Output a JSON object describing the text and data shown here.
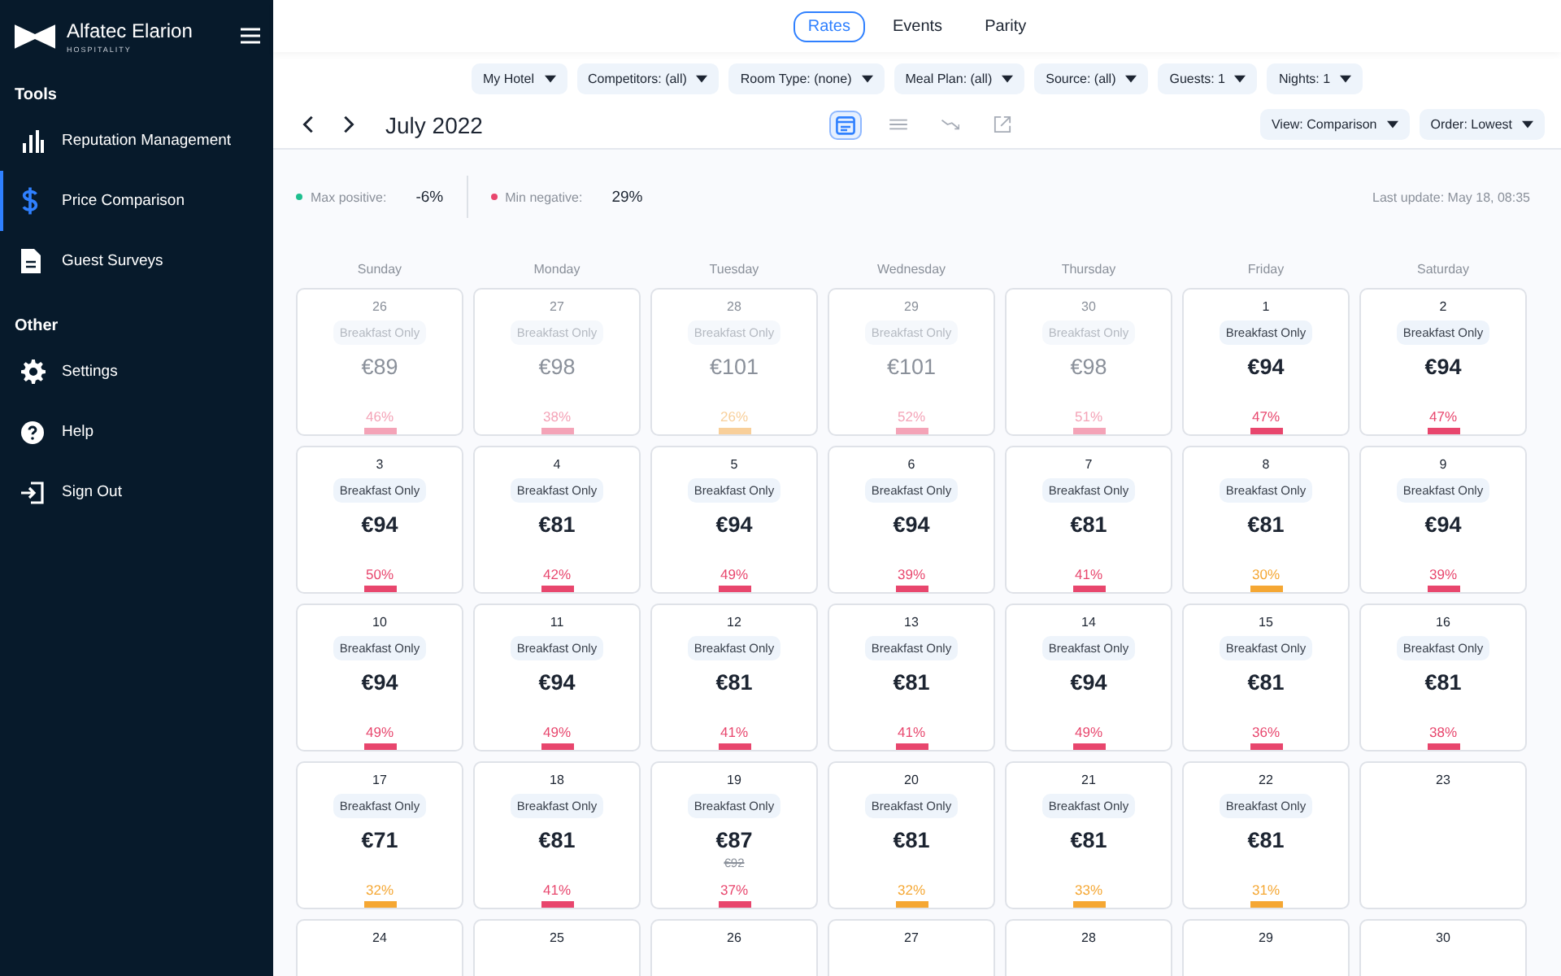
{
  "sidebar": {
    "brand": "Alfatec Elarion",
    "brand_sub": "HOSPITALITY",
    "sections": [
      {
        "title": "Tools",
        "items": [
          {
            "label": "Reputation Management",
            "selected": false
          },
          {
            "label": "Price Comparison",
            "selected": true
          },
          {
            "label": "Guest Surveys",
            "selected": false
          }
        ]
      },
      {
        "title": "Other",
        "items": [
          {
            "label": "Settings",
            "selected": false
          },
          {
            "label": "Help",
            "selected": false
          },
          {
            "label": "Sign Out",
            "selected": false
          }
        ]
      }
    ]
  },
  "tabs": [
    {
      "label": "Rates",
      "selected": true
    },
    {
      "label": "Events",
      "selected": false
    },
    {
      "label": "Parity",
      "selected": false
    }
  ],
  "filters": [
    "My Hotel",
    "Competitors: (all)",
    "Room Type: (none)",
    "Meal Plan: (all)",
    "Source: (all)",
    "Guests: 1",
    "Nights: 1"
  ],
  "toolbar": {
    "month": "July 2022",
    "views": [
      {
        "selected": true
      },
      {
        "selected": false
      },
      {
        "selected": false
      },
      {
        "selected": false
      }
    ],
    "dropdowns": [
      "View: Comparison",
      "Order: Lowest"
    ]
  },
  "stats": {
    "items": [
      {
        "label": "Max positive:",
        "value": "-6%",
        "color": "#1fbf8f"
      },
      {
        "label": "Min negative:",
        "value": "29%",
        "color": "#e8466d"
      }
    ],
    "last_update": "Last update: May 18, 08:35"
  },
  "calendar": {
    "weekdays": [
      "Sunday",
      "Monday",
      "Tuesday",
      "Wednesday",
      "Thursday",
      "Friday",
      "Saturday"
    ],
    "days": [
      {
        "date": "26",
        "past": true,
        "meal": "Breakfast Only",
        "price": "€89",
        "percent": "46%",
        "color": "#f4a3b7"
      },
      {
        "date": "27",
        "past": true,
        "meal": "Breakfast Only",
        "price": "€98",
        "percent": "38%",
        "color": "#f4a3b7"
      },
      {
        "date": "28",
        "past": true,
        "meal": "Breakfast Only",
        "price": "€101",
        "percent": "26%",
        "color": "#f8cf9a"
      },
      {
        "date": "29",
        "past": true,
        "meal": "Breakfast Only",
        "price": "€101",
        "percent": "52%",
        "color": "#f4a3b7"
      },
      {
        "date": "30",
        "past": true,
        "meal": "Breakfast Only",
        "price": "€98",
        "percent": "51%",
        "color": "#f4a3b7"
      },
      {
        "date": "1",
        "past": false,
        "meal": "Breakfast Only",
        "price": "€94",
        "percent": "47%",
        "color": "#e8466d"
      },
      {
        "date": "2",
        "past": false,
        "meal": "Breakfast Only",
        "price": "€94",
        "percent": "47%",
        "color": "#e8466d"
      },
      {
        "date": "3",
        "past": false,
        "meal": "Breakfast Only",
        "price": "€94",
        "percent": "50%",
        "color": "#e8466d"
      },
      {
        "date": "4",
        "past": false,
        "meal": "Breakfast Only",
        "price": "€81",
        "percent": "42%",
        "color": "#e8466d"
      },
      {
        "date": "5",
        "past": false,
        "meal": "Breakfast Only",
        "price": "€94",
        "percent": "49%",
        "color": "#e8466d"
      },
      {
        "date": "6",
        "past": false,
        "meal": "Breakfast Only",
        "price": "€94",
        "percent": "39%",
        "color": "#e8466d"
      },
      {
        "date": "7",
        "past": false,
        "meal": "Breakfast Only",
        "price": "€81",
        "percent": "41%",
        "color": "#e8466d"
      },
      {
        "date": "8",
        "past": false,
        "meal": "Breakfast Only",
        "price": "€81",
        "percent": "30%",
        "color": "#f5a733"
      },
      {
        "date": "9",
        "past": false,
        "meal": "Breakfast Only",
        "price": "€94",
        "percent": "39%",
        "color": "#e8466d"
      },
      {
        "date": "10",
        "past": false,
        "meal": "Breakfast Only",
        "price": "€94",
        "percent": "49%",
        "color": "#e8466d"
      },
      {
        "date": "11",
        "past": false,
        "meal": "Breakfast Only",
        "price": "€94",
        "percent": "49%",
        "color": "#e8466d"
      },
      {
        "date": "12",
        "past": false,
        "meal": "Breakfast Only",
        "price": "€81",
        "percent": "41%",
        "color": "#e8466d"
      },
      {
        "date": "13",
        "past": false,
        "meal": "Breakfast Only",
        "price": "€81",
        "percent": "41%",
        "color": "#e8466d"
      },
      {
        "date": "14",
        "past": false,
        "meal": "Breakfast Only",
        "price": "€94",
        "percent": "49%",
        "color": "#e8466d"
      },
      {
        "date": "15",
        "past": false,
        "meal": "Breakfast Only",
        "price": "€81",
        "percent": "36%",
        "color": "#e8466d"
      },
      {
        "date": "16",
        "past": false,
        "meal": "Breakfast Only",
        "price": "€81",
        "percent": "38%",
        "color": "#e8466d"
      },
      {
        "date": "17",
        "past": false,
        "meal": "Breakfast Only",
        "price": "€71",
        "percent": "32%",
        "color": "#f5a733"
      },
      {
        "date": "18",
        "past": false,
        "meal": "Breakfast Only",
        "price": "€81",
        "percent": "41%",
        "color": "#e8466d"
      },
      {
        "date": "19",
        "past": false,
        "meal": "Breakfast Only",
        "price": "€87",
        "old_price": "€92",
        "percent": "37%",
        "color": "#e8466d"
      },
      {
        "date": "20",
        "past": false,
        "meal": "Breakfast Only",
        "price": "€81",
        "percent": "32%",
        "color": "#f5a733"
      },
      {
        "date": "21",
        "past": false,
        "meal": "Breakfast Only",
        "price": "€81",
        "percent": "33%",
        "color": "#f5a733"
      },
      {
        "date": "22",
        "past": false,
        "meal": "Breakfast Only",
        "price": "€81",
        "percent": "31%",
        "color": "#f5a733"
      },
      {
        "date": "23",
        "past": false
      },
      {
        "date": "24",
        "past": false
      },
      {
        "date": "25",
        "past": false
      },
      {
        "date": "26",
        "past": false
      },
      {
        "date": "27",
        "past": false
      },
      {
        "date": "28",
        "past": false
      },
      {
        "date": "29",
        "past": false
      },
      {
        "date": "30",
        "past": false
      }
    ]
  }
}
